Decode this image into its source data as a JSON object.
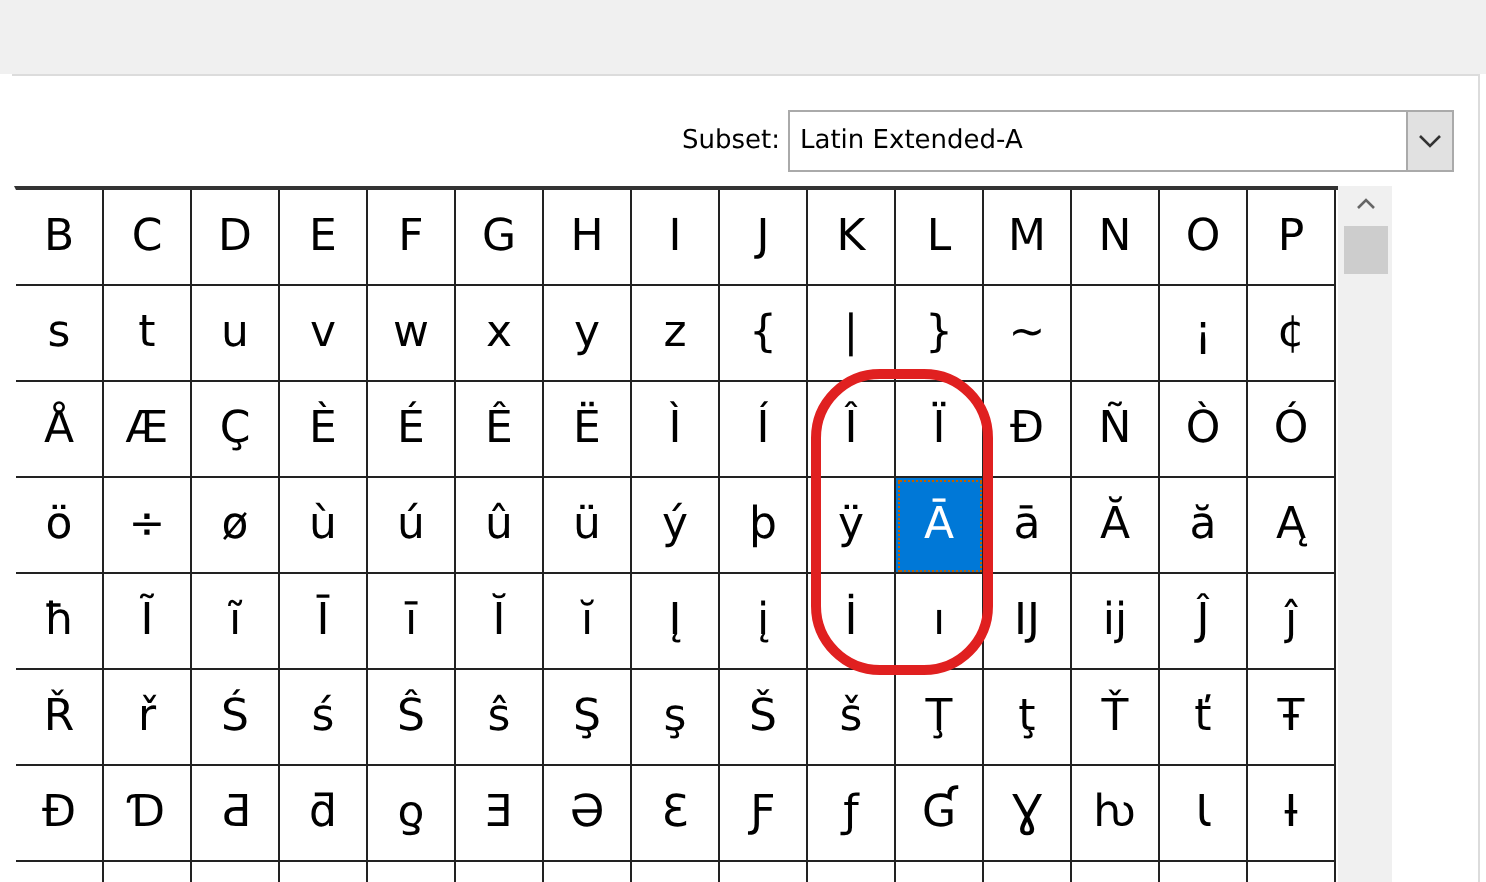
{
  "subset": {
    "label": "Subset:",
    "value": "Latin Extended-A"
  },
  "grid": {
    "rows": [
      [
        {
          "char": "B",
          "selected": false
        },
        {
          "char": "C",
          "selected": false
        },
        {
          "char": "D",
          "selected": false
        },
        {
          "char": "E",
          "selected": false
        },
        {
          "char": "F",
          "selected": false
        },
        {
          "char": "G",
          "selected": false
        },
        {
          "char": "H",
          "selected": false
        },
        {
          "char": "I",
          "selected": false
        },
        {
          "char": "J",
          "selected": false
        },
        {
          "char": "K",
          "selected": false
        },
        {
          "char": "L",
          "selected": false
        },
        {
          "char": "M",
          "selected": false
        },
        {
          "char": "N",
          "selected": false
        },
        {
          "char": "O",
          "selected": false
        },
        {
          "char": "P",
          "selected": false
        }
      ],
      [
        {
          "char": "s",
          "selected": false
        },
        {
          "char": "t",
          "selected": false
        },
        {
          "char": "u",
          "selected": false
        },
        {
          "char": "v",
          "selected": false
        },
        {
          "char": "w",
          "selected": false
        },
        {
          "char": "x",
          "selected": false
        },
        {
          "char": "y",
          "selected": false
        },
        {
          "char": "z",
          "selected": false
        },
        {
          "char": "{",
          "selected": false
        },
        {
          "char": "|",
          "selected": false
        },
        {
          "char": "}",
          "selected": false
        },
        {
          "char": "~",
          "selected": false
        },
        {
          "selected": false
        },
        {
          "char": "¡",
          "selected": false
        },
        {
          "char": "¢",
          "selected": false
        }
      ],
      [
        {
          "char": "Å",
          "selected": false
        },
        {
          "char": "Æ",
          "selected": false
        },
        {
          "char": "Ç",
          "selected": false
        },
        {
          "char": "È",
          "selected": false
        },
        {
          "char": "É",
          "selected": false
        },
        {
          "char": "Ê",
          "selected": false
        },
        {
          "char": "Ë",
          "selected": false
        },
        {
          "char": "Ì",
          "selected": false
        },
        {
          "char": "Í",
          "selected": false
        },
        {
          "char": "Î",
          "selected": false
        },
        {
          "char": "Ï",
          "selected": false
        },
        {
          "char": "Ð",
          "selected": false
        },
        {
          "char": "Ñ",
          "selected": false
        },
        {
          "char": "Ò",
          "selected": false
        },
        {
          "char": "Ó",
          "selected": false
        }
      ],
      [
        {
          "char": "ö",
          "selected": false
        },
        {
          "char": "÷",
          "selected": false
        },
        {
          "char": "ø",
          "selected": false
        },
        {
          "char": "ù",
          "selected": false
        },
        {
          "char": "ú",
          "selected": false
        },
        {
          "char": "û",
          "selected": false
        },
        {
          "char": "ü",
          "selected": false
        },
        {
          "char": "ý",
          "selected": false
        },
        {
          "char": "þ",
          "selected": false
        },
        {
          "char": "ÿ",
          "selected": false
        },
        {
          "char": "Ā",
          "selected": true
        },
        {
          "char": "ā",
          "selected": false
        },
        {
          "char": "Ă",
          "selected": false
        },
        {
          "char": "ă",
          "selected": false
        },
        {
          "char": "Ą",
          "selected": false
        }
      ],
      [
        {
          "char": "ħ",
          "selected": false
        },
        {
          "char": "Ĩ",
          "selected": false
        },
        {
          "char": "ĩ",
          "selected": false
        },
        {
          "char": "Ī",
          "selected": false
        },
        {
          "char": "ī",
          "selected": false
        },
        {
          "char": "Ĭ",
          "selected": false
        },
        {
          "char": "ĭ",
          "selected": false
        },
        {
          "char": "Į",
          "selected": false
        },
        {
          "char": "į",
          "selected": false
        },
        {
          "char": "İ",
          "selected": false
        },
        {
          "char": "ı",
          "selected": false
        },
        {
          "char": "Ĳ",
          "selected": false
        },
        {
          "char": "ĳ",
          "selected": false
        },
        {
          "char": "Ĵ",
          "selected": false
        },
        {
          "char": "ĵ",
          "selected": false
        }
      ],
      [
        {
          "char": "Ř",
          "selected": false
        },
        {
          "char": "ř",
          "selected": false
        },
        {
          "char": "Ś",
          "selected": false
        },
        {
          "char": "ś",
          "selected": false
        },
        {
          "char": "Ŝ",
          "selected": false
        },
        {
          "char": "ŝ",
          "selected": false
        },
        {
          "char": "Ş",
          "selected": false
        },
        {
          "char": "ş",
          "selected": false
        },
        {
          "char": "Š",
          "selected": false
        },
        {
          "char": "š",
          "selected": false
        },
        {
          "char": "Ţ",
          "selected": false
        },
        {
          "char": "ţ",
          "selected": false
        },
        {
          "char": "Ť",
          "selected": false
        },
        {
          "char": "ť",
          "selected": false
        },
        {
          "char": "Ŧ",
          "selected": false
        }
      ],
      [
        {
          "char": "Ɖ",
          "selected": false
        },
        {
          "char": "Ɗ",
          "selected": false
        },
        {
          "char": "Ƌ",
          "selected": false
        },
        {
          "char": "ƌ",
          "selected": false
        },
        {
          "char": "ƍ",
          "selected": false
        },
        {
          "char": "Ǝ",
          "selected": false
        },
        {
          "char": "Ə",
          "selected": false
        },
        {
          "char": "Ɛ",
          "selected": false
        },
        {
          "char": "Ƒ",
          "selected": false
        },
        {
          "char": "ƒ",
          "selected": false
        },
        {
          "char": "Ɠ",
          "selected": false
        },
        {
          "char": "Ɣ",
          "selected": false
        },
        {
          "char": "ƕ",
          "selected": false
        },
        {
          "char": "Ɩ",
          "selected": false
        },
        {
          "char": "Ɨ",
          "selected": false
        }
      ]
    ]
  }
}
